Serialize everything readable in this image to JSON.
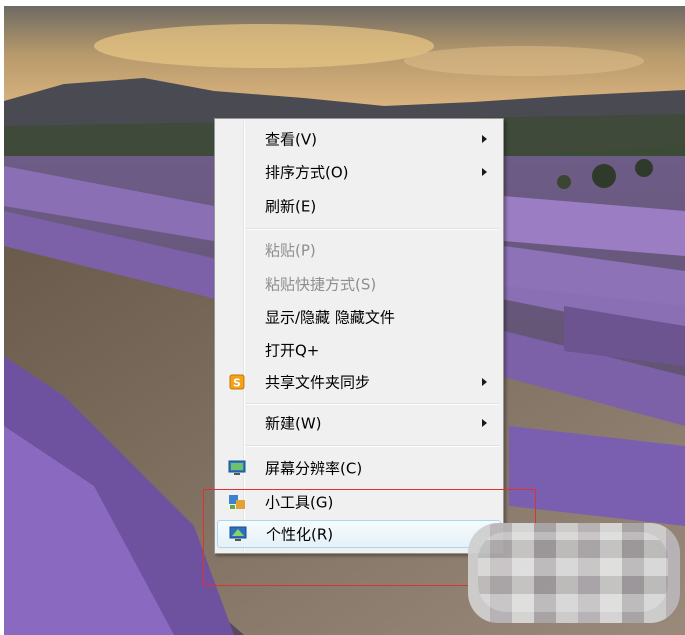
{
  "context_menu": {
    "items": [
      {
        "label": "查看(V)",
        "submenu": true,
        "disabled": false
      },
      {
        "label": "排序方式(O)",
        "submenu": true,
        "disabled": false
      },
      {
        "label": "刷新(E)",
        "submenu": false,
        "disabled": false
      },
      {
        "label": "粘贴(P)",
        "submenu": false,
        "disabled": true
      },
      {
        "label": "粘贴快捷方式(S)",
        "submenu": false,
        "disabled": true
      },
      {
        "label": "显示/隐藏 隐藏文件",
        "submenu": false,
        "disabled": false
      },
      {
        "label": "打开Q+",
        "submenu": false,
        "disabled": false
      },
      {
        "label": "共享文件夹同步",
        "submenu": true,
        "disabled": false,
        "icon": "sync-s-icon"
      },
      {
        "label": "新建(W)",
        "submenu": true,
        "disabled": false
      },
      {
        "label": "屏幕分辨率(C)",
        "submenu": false,
        "disabled": false,
        "icon": "monitor-icon"
      },
      {
        "label": "小工具(G)",
        "submenu": false,
        "disabled": false,
        "icon": "gadgets-icon"
      },
      {
        "label": "个性化(R)",
        "submenu": false,
        "disabled": false,
        "icon": "personalize-icon",
        "highlighted": true
      }
    ]
  },
  "colors": {
    "highlight_box": "#e03030",
    "menu_bg": "#f0f0f0",
    "lavender": "#7b5aa6"
  }
}
